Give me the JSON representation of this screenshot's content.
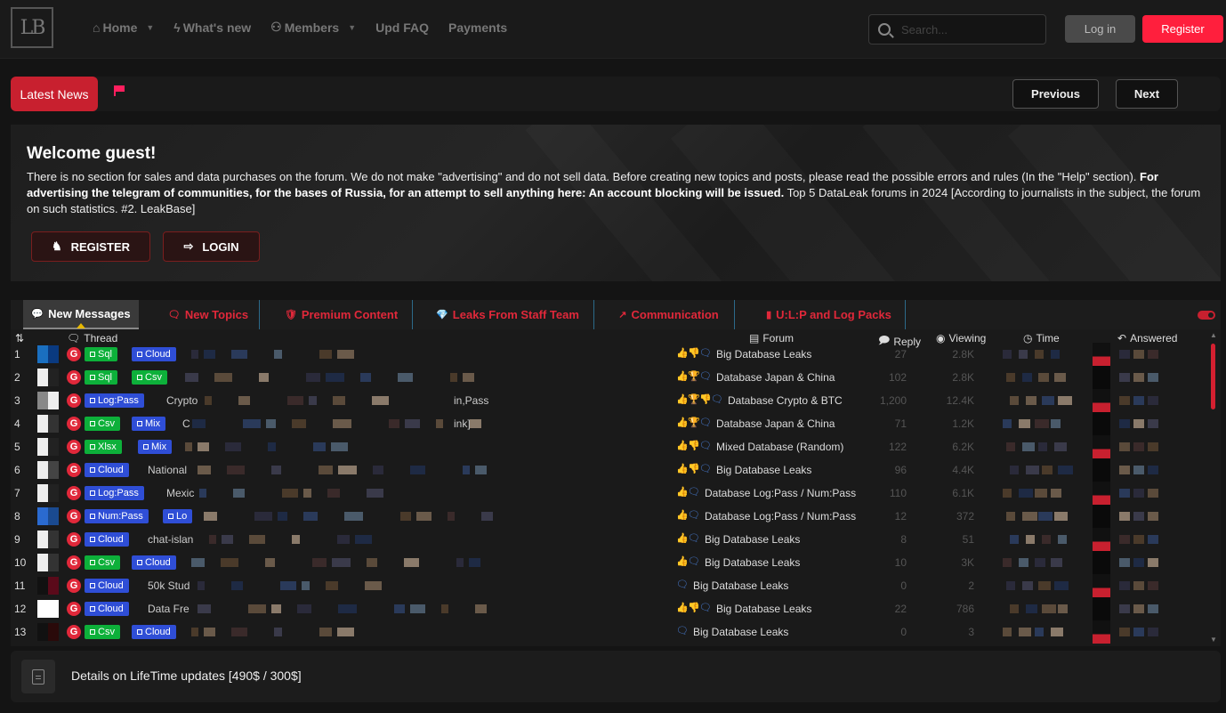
{
  "header": {
    "logo_text": "LB",
    "nav": [
      {
        "icon": "home-icon",
        "glyph": "⌂",
        "label": "Home",
        "dropdown": true
      },
      {
        "icon": "bolt-icon",
        "glyph": "ϟ",
        "label": "What's new",
        "dropdown": false
      },
      {
        "icon": "users-icon",
        "glyph": "⚇",
        "label": "Members",
        "dropdown": true
      },
      {
        "icon": "",
        "glyph": "",
        "label": "Upd FAQ",
        "dropdown": false
      },
      {
        "icon": "",
        "glyph": "",
        "label": "Payments",
        "dropdown": false
      }
    ],
    "search_placeholder": "Search...",
    "login_label": "Log in",
    "register_label": "Register"
  },
  "newsbar": {
    "label": "Latest News",
    "prev_label": "Previous",
    "next_label": "Next"
  },
  "welcome": {
    "title": "Welcome guest!",
    "text_1": "There is no section for sales and data purchases on the forum. We do not make \"advertising\" and do not sell data. Before creating new topics and posts, please read the possible errors and rules (In the \"Help\" section). ",
    "text_bold": "For advertising the telegram of communities, for the bases of Russia, for an attempt to sell anything here: An account blocking will be issued.",
    "text_2": " Top 5 DataLeak forums in 2024 [According to journalists in the subject, the forum on such statistics. #2. LeakBase]",
    "register_label": "REGISTER",
    "login_label": "LOGIN"
  },
  "tabs": [
    {
      "label": "New Messages",
      "active": true
    },
    {
      "label": "New Topics",
      "active": false
    },
    {
      "label": "Premium Content",
      "active": false
    },
    {
      "label": "Leaks From Staff Team",
      "active": false
    },
    {
      "label": "Communication",
      "active": false
    },
    {
      "label": "U:L:P and Log Packs",
      "active": false
    }
  ],
  "table": {
    "headers": {
      "thread": "Thread",
      "forum": "Forum",
      "reply": "Reply",
      "viewing": "Viewing",
      "time": "Time",
      "answered": "Answered"
    },
    "rows": [
      {
        "n": "1",
        "tags": [
          [
            "Sql",
            "green"
          ],
          [
            "Cloud",
            "blue"
          ]
        ],
        "title": "",
        "icons": [
          "like",
          "dislike",
          "chat"
        ],
        "forum": "Big Database Leaks",
        "reply": "27",
        "views": "2.8K"
      },
      {
        "n": "2",
        "tags": [
          [
            "Sql",
            "green"
          ],
          [
            "Csv",
            "green"
          ]
        ],
        "title": "",
        "icons": [
          "like",
          "trophy",
          "chat"
        ],
        "forum": "Database Japan & China",
        "reply": "102",
        "views": "2.8K"
      },
      {
        "n": "3",
        "tags": [
          [
            "Log:Pass",
            "blue"
          ]
        ],
        "title": "Crypto",
        "title_end": "in,Pass",
        "icons": [
          "like",
          "trophy",
          "dislike",
          "chat"
        ],
        "forum": "Database Crypto & BTC",
        "reply": "1,200",
        "views": "12.4K"
      },
      {
        "n": "4",
        "tags": [
          [
            "Csv",
            "green"
          ],
          [
            "Mix",
            "blue"
          ]
        ],
        "title": "C",
        "title_end": "ink]",
        "icons": [
          "like",
          "trophy",
          "chat"
        ],
        "forum": "Database Japan & China",
        "reply": "71",
        "views": "1.2K"
      },
      {
        "n": "5",
        "tags": [
          [
            "Xlsx",
            "green"
          ],
          [
            "Mix",
            "blue"
          ]
        ],
        "title": "",
        "icons": [
          "like",
          "dislike",
          "chat"
        ],
        "forum": "Mixed Database (Random)",
        "reply": "122",
        "views": "6.2K"
      },
      {
        "n": "6",
        "tags": [
          [
            "Cloud",
            "blue"
          ]
        ],
        "title": "National",
        "icons": [
          "like",
          "dislike",
          "chat"
        ],
        "forum": "Big Database Leaks",
        "reply": "96",
        "views": "4.4K"
      },
      {
        "n": "7",
        "tags": [
          [
            "Log:Pass",
            "blue"
          ]
        ],
        "title": "Mexic",
        "icons": [
          "like",
          "chat"
        ],
        "forum": "Database Log:Pass / Num:Pass",
        "reply": "110",
        "views": "6.1K"
      },
      {
        "n": "8",
        "tags": [
          [
            "Num:Pass",
            "blue"
          ],
          [
            "Lo",
            "blue"
          ]
        ],
        "title": "",
        "icons": [
          "like",
          "chat"
        ],
        "forum": "Database Log:Pass / Num:Pass",
        "reply": "12",
        "views": "372"
      },
      {
        "n": "9",
        "tags": [
          [
            "Cloud",
            "blue"
          ]
        ],
        "title": "chat-islan",
        "icons": [
          "like",
          "chat"
        ],
        "forum": "Big Database Leaks",
        "reply": "8",
        "views": "51"
      },
      {
        "n": "10",
        "tags": [
          [
            "Csv",
            "green"
          ],
          [
            "Cloud",
            "blue"
          ]
        ],
        "title": "",
        "icons": [
          "like",
          "chat"
        ],
        "forum": "Big Database Leaks",
        "reply": "10",
        "views": "3K"
      },
      {
        "n": "11",
        "tags": [
          [
            "Cloud",
            "blue"
          ]
        ],
        "title": "50k Stud",
        "icons": [
          "chat"
        ],
        "forum": "Big Database Leaks",
        "reply": "0",
        "views": "2"
      },
      {
        "n": "12",
        "tags": [
          [
            "Cloud",
            "blue"
          ]
        ],
        "title": "Data Fre",
        "icons": [
          "like",
          "dislike",
          "chat"
        ],
        "forum": "Big Database Leaks",
        "reply": "22",
        "views": "786"
      },
      {
        "n": "13",
        "tags": [
          [
            "Csv",
            "green"
          ],
          [
            "Cloud",
            "blue"
          ]
        ],
        "title": "",
        "icons": [
          "chat"
        ],
        "forum": "Big Database Leaks",
        "reply": "0",
        "views": "3"
      }
    ]
  },
  "footer": {
    "text": "Details on LifeTime updates [490$ / 300$]"
  },
  "colors": {
    "accent_red": "#ff1f3d",
    "tab_red": "#e0283a",
    "tag_green": "#0db03a",
    "tag_blue": "#2f4ed6"
  }
}
